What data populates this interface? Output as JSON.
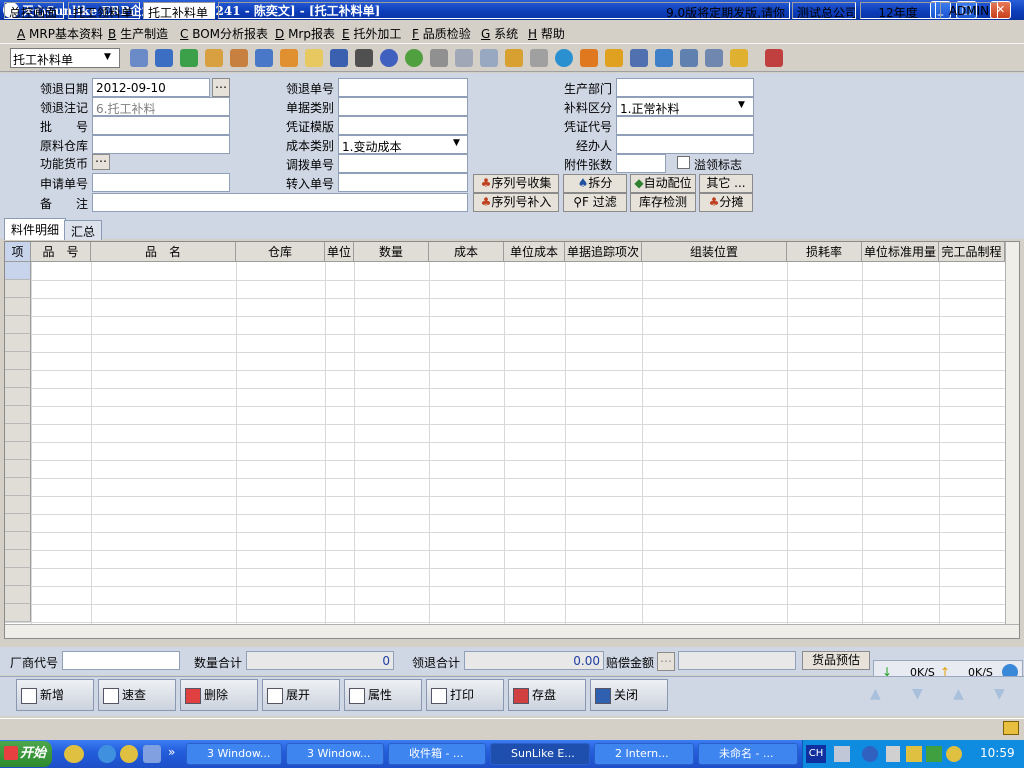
{
  "window": {
    "title": "天心Sunlike ERP企业管理软件[1241 - 陈奕文] - [托工补料单]",
    "min": "_",
    "max": "□",
    "close": "✕"
  },
  "menu": [
    {
      "key": "A",
      "label": "MRP基本资料"
    },
    {
      "key": "B",
      "label": "生产制造"
    },
    {
      "key": "C",
      "label": "BOM分析报表"
    },
    {
      "key": "D",
      "label": "Mrp报表"
    },
    {
      "key": "E",
      "label": "托外加工"
    },
    {
      "key": "F",
      "label": "品质检验"
    },
    {
      "key": "G",
      "label": "系统"
    },
    {
      "key": "H",
      "label": "帮助"
    }
  ],
  "toolbar": {
    "doc_type": "托工补料单"
  },
  "form": {
    "return_date_label": "领退日期",
    "return_date": "2012-09-10",
    "return_note_label": "领退注记",
    "return_note": "6.托工补料",
    "batch_label": "批　　号",
    "batch": "",
    "material_wh_label": "原料仓库",
    "material_wh": "",
    "currency_label": "功能货币",
    "apply_no_label": "申请单号",
    "apply_no": "",
    "remark_label": "备　　注",
    "remark": "",
    "return_no_label": "领退单号",
    "return_no": "",
    "doc_category_label": "单据类别",
    "doc_category": "",
    "voucher_tpl_label": "凭证模版",
    "voucher_tpl": "",
    "cost_type_label": "成本类别",
    "cost_type": "1.变动成本",
    "transfer_no_label": "调拨单号",
    "transfer_no": "",
    "transfer_in_label": "转入单号",
    "transfer_in": "",
    "prod_dept_label": "生产部门",
    "prod_dept": "",
    "supp_area_label": "补料区分",
    "supp_area": "1.正常补料",
    "voucher_code_label": "凭证代号",
    "voucher_code": "",
    "handler_label": "经办人",
    "handler": "",
    "attach_label": "附件张数",
    "attach": "",
    "overflow_label": "溢领标志",
    "btn_serial_collect": "序列号收集",
    "btn_split": "拆分",
    "btn_auto": "自动配位",
    "btn_other": "其它 ...",
    "btn_serial_add": "序列号补入",
    "btn_filter": "F 过滤",
    "btn_stock": "库存检测",
    "btn_allocate": "分摊"
  },
  "tabs": [
    "料件明细",
    "汇总"
  ],
  "grid": {
    "columns": [
      "项",
      "品　号",
      "品　名",
      "仓库",
      "单位",
      "数量",
      "成本",
      "单位成本",
      "单据追踪项次",
      "组装位置",
      "损耗率",
      "单位标准用量",
      "完工品制程"
    ]
  },
  "summary": {
    "vendor_label": "厂商代号",
    "vendor": "",
    "qty_total_label": "数量合计",
    "qty_total": "0",
    "ret_total_label": "领退合计",
    "ret_total": "0.00",
    "comp_label": "赔偿金额",
    "goods_btn": "货品预估",
    "dl_rate": "0K/S",
    "ul_rate": "0K/S"
  },
  "actions": [
    "新增",
    "速查",
    "删除",
    "展开",
    "属性",
    "打印",
    "存盘",
    "关闭"
  ],
  "status": {
    "tab1": "总控画面",
    "tab2": "托工领料单",
    "tab3": "托工补料单",
    "notice": "9.0版将定期发版,请你",
    "company": "测试总公司",
    "year": "12年度",
    "user": "ADMIN"
  },
  "taskbar": {
    "start": "开始",
    "tasks": [
      "3 Window...",
      "3 Window...",
      "收件箱 - ...",
      "SunLike E...",
      "2 Intern...",
      "未命名 - ..."
    ],
    "lang": "CH",
    "clock": "10:59"
  }
}
